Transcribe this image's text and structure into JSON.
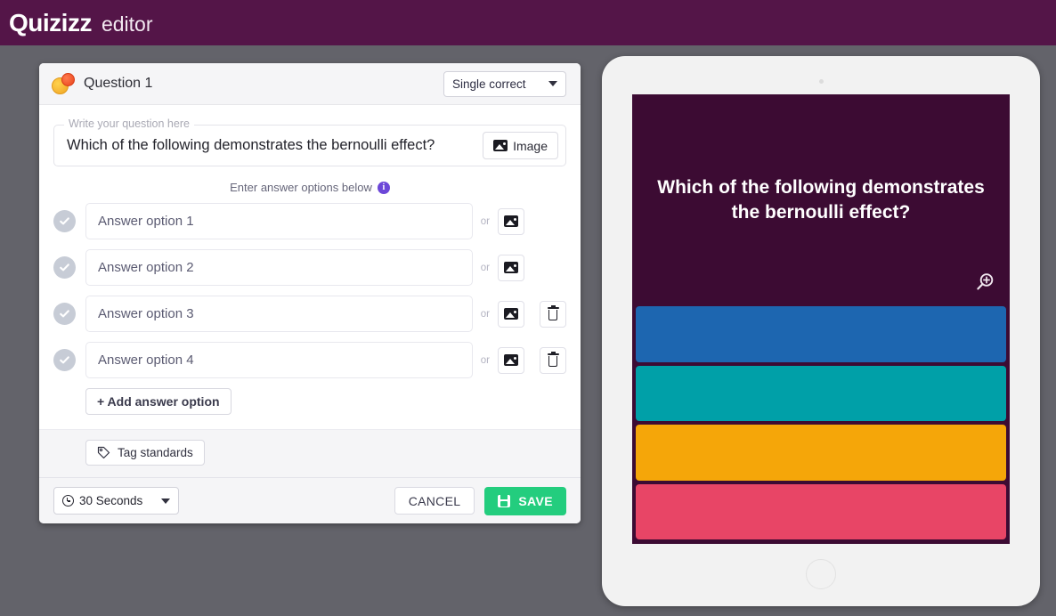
{
  "topbar": {
    "logo_main": "Quizizz",
    "logo_sub": "editor"
  },
  "editor": {
    "header": {
      "question_label": "Question 1",
      "question_icon": "quiz-bubble-icon",
      "type_value": "Single correct"
    },
    "question_field": {
      "legend": "Write your question here",
      "value": "Which of the following demonstrates the bernoulli effect?",
      "image_button": "Image"
    },
    "hint": "Enter answer options below",
    "info_icon": "info-icon",
    "or_label": "or",
    "answers": [
      {
        "placeholder": "Answer option 1",
        "deletable": false
      },
      {
        "placeholder": "Answer option 2",
        "deletable": false
      },
      {
        "placeholder": "Answer option 3",
        "deletable": true
      },
      {
        "placeholder": "Answer option 4",
        "deletable": true
      }
    ],
    "add_answer_label": "+ Add answer option",
    "tag_standards_label": "Tag standards",
    "footer": {
      "timer_value": "30 Seconds",
      "cancel_label": "CANCEL",
      "save_label": "SAVE"
    }
  },
  "preview": {
    "question_text": "Which of the following demonstrates the bernoulli effect?",
    "zoom_icon": "zoom-in-icon",
    "choice_colors": [
      "#1d66b0",
      "#00a0a8",
      "#f5a609",
      "#e84566"
    ],
    "background": "#3c0b33"
  },
  "colors": {
    "brand_purple": "#541548",
    "page_background": "#63636a",
    "save_green": "#23cd7e",
    "info_purple": "#6c47d8"
  }
}
